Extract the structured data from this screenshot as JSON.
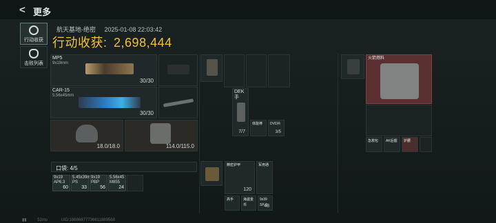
{
  "header": {
    "back_symbol": "<",
    "title": "更多"
  },
  "sidebar": {
    "tabs": [
      {
        "label": "行动收获",
        "active": true
      },
      {
        "label": "击败列表",
        "active": false
      }
    ]
  },
  "info": {
    "location": "航天基地-绝密",
    "datetime": "2025-01-08 22:03:42",
    "harvest_label": "行动收获:",
    "harvest_value": "2,698,444"
  },
  "weapons": [
    {
      "name": "MP5",
      "caliber": "9x19mm",
      "count": "30/30"
    },
    {
      "name": "CAR-15",
      "caliber": "5.56x45mm",
      "count": "30/30"
    }
  ],
  "armor": {
    "helmet": "18.0/18.0",
    "vest": "114.0/115.0"
  },
  "rig": {
    "item_label": "DEK手",
    "item_count": "7/7",
    "small1": "体能棒",
    "small2": "DVD片",
    "small2_count": "3/5"
  },
  "pocket": {
    "label": "口袋: 4/5"
  },
  "ammo": [
    {
      "type": "9x19 AP6.3",
      "count": "60"
    },
    {
      "type": "5.45x39mm PS",
      "count": "33"
    },
    {
      "type": "9x19 PBP",
      "count": "56"
    },
    {
      "type": "5.56x45 M855",
      "count": "24"
    }
  ],
  "bag": {
    "item1": "精密护甲",
    "item2": "军用通",
    "count1": "120",
    "item3": "高手",
    "item4": "海盗金币",
    "item5": "9x39 SP-5",
    "count5": "48"
  },
  "container": {
    "name": "火箭燃料",
    "small1": "急救包",
    "small2": "AK后握",
    "small3": "护腰"
  },
  "footer": {
    "ping": "52ms",
    "uid": "UID:18686877736611889568"
  }
}
